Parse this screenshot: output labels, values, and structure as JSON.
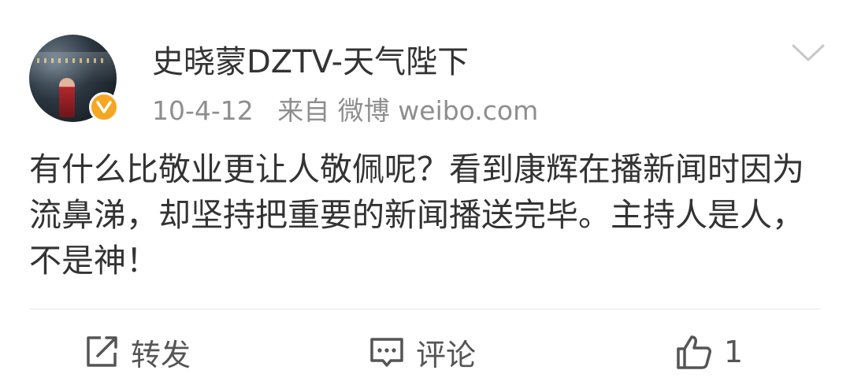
{
  "author": {
    "name": "史晓蒙DZTV-天气陛下",
    "verified_icon": "verified-v-icon",
    "verified_color": "#f5a623"
  },
  "meta": {
    "date": "10-4-12",
    "source": "来自 微博 weibo.com"
  },
  "post": {
    "text": "有什么比敬业更让人敬佩呢？看到康辉在播新闻时因为流鼻涕，却坚持把重要的新闻播送完毕。主持人是人，不是神！"
  },
  "actions": {
    "repost_label": "转发",
    "comment_label": "评论",
    "like_count": "1"
  }
}
